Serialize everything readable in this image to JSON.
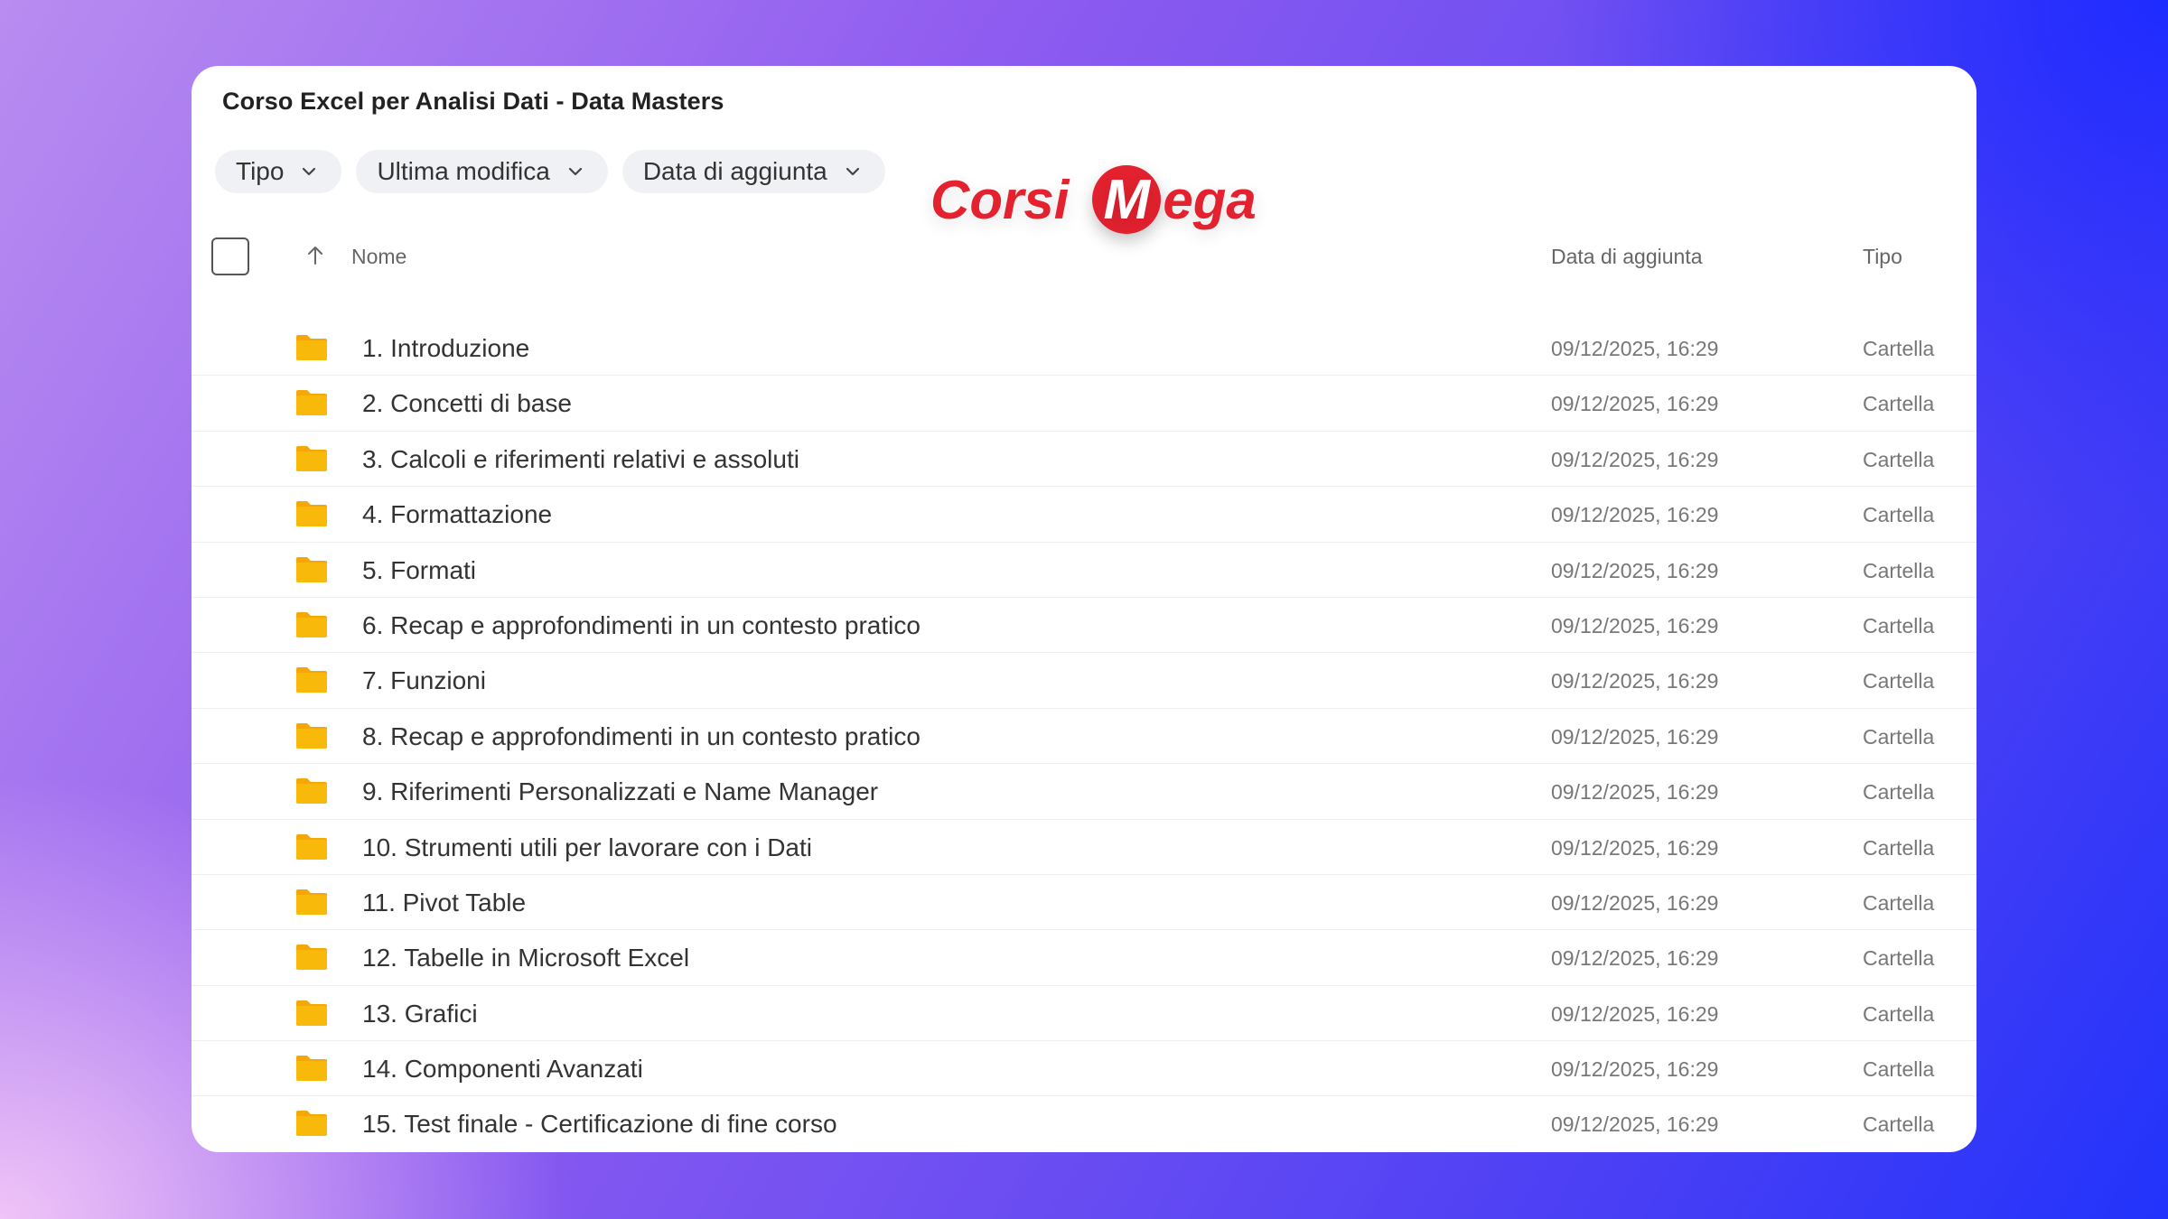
{
  "window": {
    "title": "Corso Excel per Analisi Dati - Data Masters"
  },
  "filters": [
    {
      "label": "Tipo"
    },
    {
      "label": "Ultima modifica"
    },
    {
      "label": "Data di aggiunta"
    }
  ],
  "watermark": {
    "text_left": "Corsi",
    "badge": "M",
    "text_right": "ega",
    "color": "#e3212f"
  },
  "table": {
    "columns": {
      "name": "Nome",
      "date_added": "Data di aggiunta",
      "type": "Tipo"
    },
    "rows": [
      {
        "name": "1. Introduzione",
        "date": "09/12/2025, 16:29",
        "type": "Cartella"
      },
      {
        "name": "2. Concetti di base",
        "date": "09/12/2025, 16:29",
        "type": "Cartella"
      },
      {
        "name": "3. Calcoli e riferimenti relativi e assoluti",
        "date": "09/12/2025, 16:29",
        "type": "Cartella"
      },
      {
        "name": "4. Formattazione",
        "date": "09/12/2025, 16:29",
        "type": "Cartella"
      },
      {
        "name": "5. Formati",
        "date": "09/12/2025, 16:29",
        "type": "Cartella"
      },
      {
        "name": "6. Recap e approfondimenti in un contesto pratico",
        "date": "09/12/2025, 16:29",
        "type": "Cartella"
      },
      {
        "name": "7. Funzioni",
        "date": "09/12/2025, 16:29",
        "type": "Cartella"
      },
      {
        "name": "8. Recap e approfondimenti in un contesto pratico",
        "date": "09/12/2025, 16:29",
        "type": "Cartella"
      },
      {
        "name": "9. Riferimenti Personalizzati e Name Manager",
        "date": "09/12/2025, 16:29",
        "type": "Cartella"
      },
      {
        "name": "10. Strumenti utili per lavorare con i Dati",
        "date": "09/12/2025, 16:29",
        "type": "Cartella"
      },
      {
        "name": "11. Pivot Table",
        "date": "09/12/2025, 16:29",
        "type": "Cartella"
      },
      {
        "name": "12. Tabelle in Microsoft Excel",
        "date": "09/12/2025, 16:29",
        "type": "Cartella"
      },
      {
        "name": "13. Grafici",
        "date": "09/12/2025, 16:29",
        "type": "Cartella"
      },
      {
        "name": "14. Componenti Avanzati",
        "date": "09/12/2025, 16:29",
        "type": "Cartella"
      },
      {
        "name": "15. Test finale - Certificazione di fine corso",
        "date": "09/12/2025, 16:29",
        "type": "Cartella"
      }
    ]
  },
  "colors": {
    "folder": "#f9b90b",
    "folder_back": "#f6a708"
  }
}
